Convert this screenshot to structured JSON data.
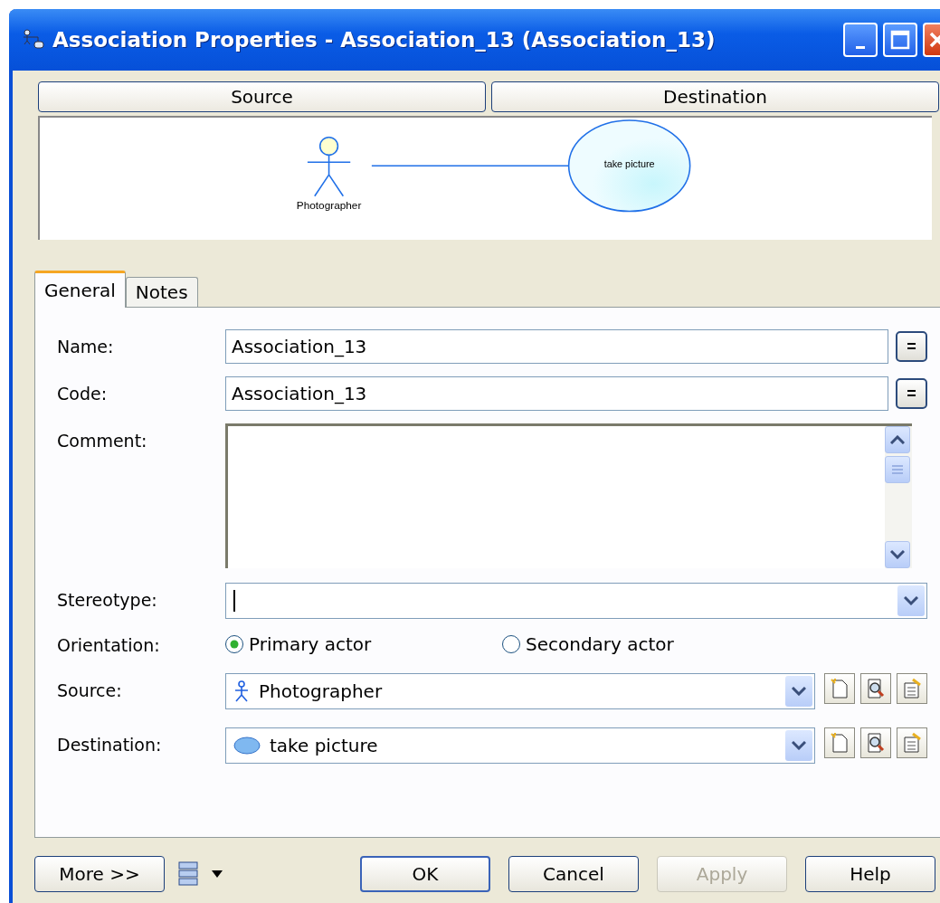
{
  "window": {
    "title": "Association Properties - Association_13 (Association_13)"
  },
  "role_headers": [
    "Source",
    "Destination"
  ],
  "diagram": {
    "source": "Photographer",
    "destination": "take picture"
  },
  "tabs": [
    {
      "label": "General",
      "selected": true
    },
    {
      "label": "Notes",
      "selected": false
    }
  ],
  "fields": [
    {
      "kind": "text",
      "label": "Name:",
      "value": "Association_13",
      "button": "="
    },
    {
      "kind": "text",
      "label": "Code:",
      "value": "Association_13",
      "button": "="
    },
    {
      "kind": "textarea",
      "label": "Comment:"
    },
    {
      "kind": "combo",
      "label": "Stereotype:",
      "focused": true
    }
  ],
  "orientation": {
    "label": "Orientation:",
    "options": [
      {
        "label": "Primary actor",
        "selected": true
      },
      {
        "label": "Secondary actor",
        "selected": false
      }
    ]
  },
  "links": [
    {
      "kind": "actor",
      "label": "Source:",
      "value": "Photographer"
    },
    {
      "kind": "usecase",
      "label": "Destination:",
      "value": "take picture"
    }
  ],
  "footer": {
    "left": "More >>",
    "buttons": [
      {
        "label": "OK",
        "default": true,
        "disabled": false
      },
      {
        "label": "Cancel",
        "default": false,
        "disabled": false
      },
      {
        "label": "Apply",
        "default": false,
        "disabled": true
      },
      {
        "label": "Help",
        "default": false,
        "disabled": false
      }
    ]
  }
}
